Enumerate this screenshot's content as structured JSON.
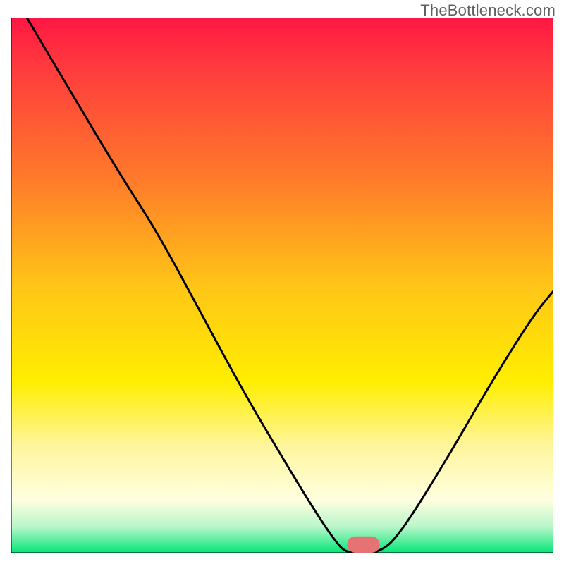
{
  "watermark": "TheBottleneck.com",
  "colors": {
    "red": "#ff1744",
    "orange": "#ff9100",
    "yellow": "#ffee00",
    "paleyellow": "#ffff8d",
    "green": "#00e676",
    "curve": "#000000",
    "axis": "#000000",
    "marker": "#e57373"
  },
  "chart_data": {
    "type": "line",
    "title": "",
    "xlabel": "",
    "ylabel": "",
    "xlim": [
      0,
      100
    ],
    "ylim": [
      0,
      100
    ],
    "curve": [
      {
        "x": 3,
        "y": 100
      },
      {
        "x": 10,
        "y": 88
      },
      {
        "x": 20,
        "y": 71
      },
      {
        "x": 27,
        "y": 60
      },
      {
        "x": 35,
        "y": 45
      },
      {
        "x": 43,
        "y": 30
      },
      {
        "x": 50,
        "y": 18
      },
      {
        "x": 56,
        "y": 8
      },
      {
        "x": 60,
        "y": 2
      },
      {
        "x": 62,
        "y": 0
      },
      {
        "x": 68,
        "y": 0
      },
      {
        "x": 72,
        "y": 4
      },
      {
        "x": 80,
        "y": 17
      },
      {
        "x": 88,
        "y": 31
      },
      {
        "x": 96,
        "y": 44
      },
      {
        "x": 100,
        "y": 49
      }
    ],
    "marker": {
      "x": 65,
      "y": 0,
      "w": 6,
      "h": 2
    },
    "grid": false,
    "gradient_bands": [
      {
        "stop": 0.0,
        "color": "#ff1744"
      },
      {
        "stop": 0.1,
        "color": "#ff3d3d"
      },
      {
        "stop": 0.3,
        "color": "#ff7a2a"
      },
      {
        "stop": 0.5,
        "color": "#ffc517"
      },
      {
        "stop": 0.68,
        "color": "#ffee00"
      },
      {
        "stop": 0.8,
        "color": "#fff59d"
      },
      {
        "stop": 0.9,
        "color": "#ffffe0"
      },
      {
        "stop": 0.95,
        "color": "#b9f6ca"
      },
      {
        "stop": 1.0,
        "color": "#00e676"
      }
    ]
  }
}
